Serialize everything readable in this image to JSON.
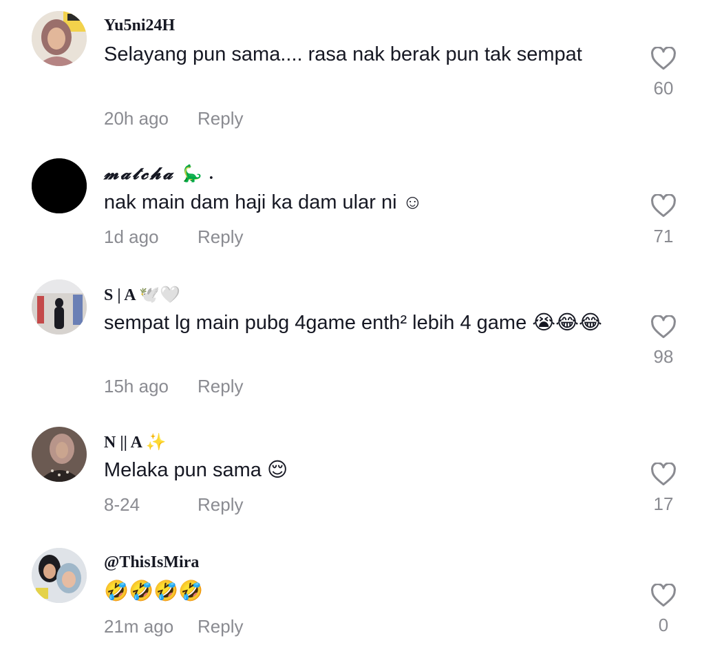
{
  "comments": [
    {
      "username": "Yu5ni24H",
      "text": "Selayang pun sama.... rasa nak berak pun tak sempat",
      "time": "20h ago",
      "reply": "Reply",
      "likes": "60"
    },
    {
      "username": "𝓶𝓪𝓽𝓬𝓱𝓪 🦕 .",
      "text": "nak main dam haji ka dam ular ni ☺",
      "time": "1d ago",
      "reply": "Reply",
      "likes": "71"
    },
    {
      "username": "S | A 🕊️🤍",
      "text": "sempat lg main pubg 4game enth² lebih 4 game 😭😂😂",
      "time": "15h ago",
      "reply": "Reply",
      "likes": "98"
    },
    {
      "username": "N || A ✨",
      "text": "Melaka pun sama 😌",
      "time": "8-24",
      "reply": "Reply",
      "likes": "17"
    },
    {
      "username": "@ThisIsMira",
      "text": "🤣🤣🤣🤣",
      "time": "21m ago",
      "reply": "Reply",
      "likes": "0"
    }
  ],
  "icons": {
    "avatar": "avatar-image",
    "like": "heart-outline-icon"
  },
  "colors": {
    "text": "#161823",
    "muted": "#8a8b91",
    "background": "#ffffff"
  }
}
